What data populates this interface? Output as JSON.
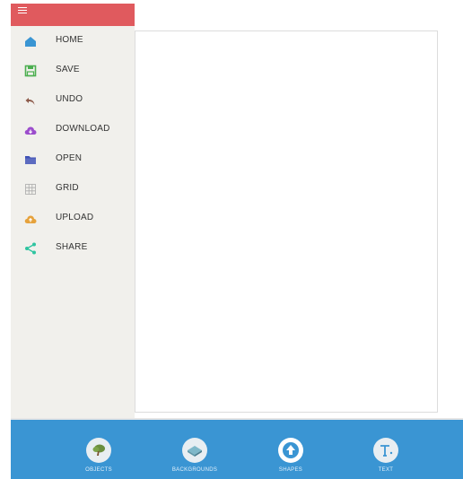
{
  "colors": {
    "drawer_header": "#e05a5e",
    "drawer_bg": "#f1f0ec",
    "bottom_bar": "#3a95d3"
  },
  "drawer": {
    "menu_icon": "hamburger-icon",
    "items": [
      {
        "label": "HOME",
        "icon": "home-icon",
        "color": "#3a95d3"
      },
      {
        "label": "SAVE",
        "icon": "save-icon",
        "color": "#4caf50"
      },
      {
        "label": "UNDO",
        "icon": "undo-icon",
        "color": "#8d5a4a"
      },
      {
        "label": "DOWNLOAD",
        "icon": "cloud-download-icon",
        "color": "#9c4dcc"
      },
      {
        "label": "OPEN",
        "icon": "folder-icon",
        "color": "#3f51b5"
      },
      {
        "label": "GRID",
        "icon": "grid-icon",
        "color": "#aaaaaa"
      },
      {
        "label": "UPLOAD",
        "icon": "cloud-upload-icon",
        "color": "#e6a23c"
      },
      {
        "label": "SHARE",
        "icon": "share-icon",
        "color": "#2ec4a0"
      }
    ]
  },
  "bottom_tabs": [
    {
      "label": "OBJECTS",
      "icon": "tree-icon"
    },
    {
      "label": "BACKGROUNDS",
      "icon": "background-icon"
    },
    {
      "label": "SHAPES",
      "icon": "arrow-up-icon"
    },
    {
      "label": "TEXT",
      "icon": "text-icon"
    }
  ]
}
